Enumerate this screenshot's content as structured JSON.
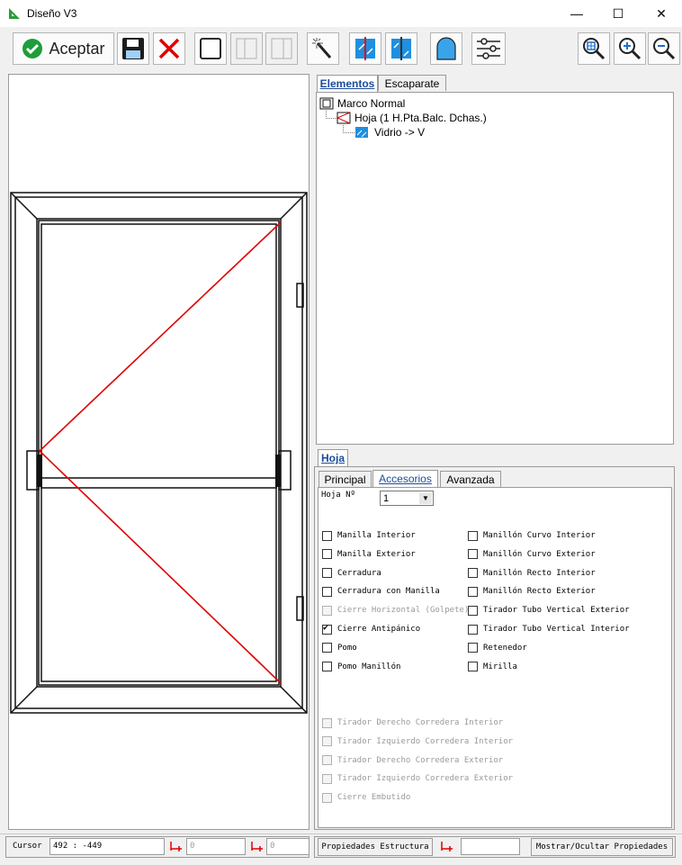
{
  "window": {
    "title": "Diseño V3",
    "minimize": "—",
    "maximize": "☐",
    "close": "✕"
  },
  "toolbar": {
    "accept_label": "Aceptar",
    "icons": [
      "check-icon",
      "save-icon",
      "cancel-icon",
      "frame-icon",
      "split-icon",
      "split2-icon",
      "wand-icon",
      "glass-icon",
      "glass2-icon",
      "arch-icon",
      "sliders-icon",
      "zoom-fit-icon",
      "zoom-in-icon",
      "zoom-out-icon"
    ]
  },
  "tree_tabs": {
    "elementos": "Elementos",
    "escaparate": "Escaparate"
  },
  "tree": {
    "root": "Marco Normal",
    "child": "Hoja (1 H.Pta.Balc. Dchas.)",
    "leaf": "Vidrio -> V"
  },
  "props": {
    "main_tab": "Hoja",
    "subtabs": {
      "principal": "Principal",
      "accesorios": "Accesorios",
      "avanzada": "Avanzada"
    },
    "hoja_label": "Hoja Nº",
    "hoja_value": "1",
    "left_checks": [
      {
        "label": "Manilla Interior",
        "checked": false,
        "disabled": false
      },
      {
        "label": "Manilla Exterior",
        "checked": false,
        "disabled": false
      },
      {
        "label": "Cerradura",
        "checked": false,
        "disabled": false
      },
      {
        "label": "Cerradura con Manilla",
        "checked": false,
        "disabled": false
      },
      {
        "label": "Cierre Horizontal (Golpete)",
        "checked": false,
        "disabled": true
      },
      {
        "label": "Cierre Antipánico",
        "checked": true,
        "disabled": false
      },
      {
        "label": "Pomo",
        "checked": false,
        "disabled": false
      },
      {
        "label": "Pomo Manillón",
        "checked": false,
        "disabled": false
      }
    ],
    "right_checks": [
      {
        "label": "Manillón Curvo Interior",
        "checked": false,
        "disabled": false
      },
      {
        "label": "Manillón Curvo Exterior",
        "checked": false,
        "disabled": false
      },
      {
        "label": "Manillón Recto Interior",
        "checked": false,
        "disabled": false
      },
      {
        "label": "Manillón Recto Exterior",
        "checked": false,
        "disabled": false
      },
      {
        "label": "Tirador Tubo Vertical Exterior",
        "checked": false,
        "disabled": false
      },
      {
        "label": "Tirador Tubo Vertical Interior",
        "checked": false,
        "disabled": false
      },
      {
        "label": "Retenedor",
        "checked": false,
        "disabled": false
      },
      {
        "label": "Mirilla",
        "checked": false,
        "disabled": false
      }
    ],
    "bottom_checks": [
      {
        "label": "Tirador Derecho Corredera Interior",
        "checked": false,
        "disabled": true
      },
      {
        "label": "Tirador Izquierdo Corredera Interior",
        "checked": false,
        "disabled": true
      },
      {
        "label": "Tirador Derecho Corredera Exterior",
        "checked": false,
        "disabled": true
      },
      {
        "label": "Tirador Izquierdo Corredera Exterior",
        "checked": false,
        "disabled": true
      },
      {
        "label": "Cierre Embutido",
        "checked": false,
        "disabled": true
      }
    ]
  },
  "status": {
    "cursor_label": "Cursor",
    "cursor_value": "492 : -449",
    "field1": "0",
    "field2": "0",
    "field3": "",
    "props_button": "Propiedades Estructura",
    "toggle_button": "Mostrar/Ocultar Propiedades"
  },
  "colors": {
    "accent": "#1a4c9a",
    "opening_line": "#e00000",
    "accept": "#1e9e3a",
    "cancel": "#e00000",
    "glass": "#1f8fe0"
  }
}
